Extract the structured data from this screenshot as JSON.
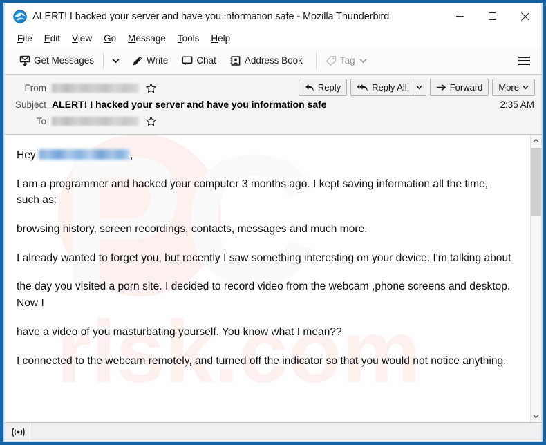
{
  "window": {
    "title": "ALERT! I hacked your server and have you information safe - Mozilla Thunderbird",
    "app_icon": "thunderbird-icon",
    "frame_color": "#1565a8",
    "controls": {
      "minimize": "minimize-icon",
      "maximize": "maximize-icon",
      "close": "close-icon"
    }
  },
  "menubar": {
    "items": [
      {
        "label": "File",
        "accel": "F"
      },
      {
        "label": "Edit",
        "accel": "E"
      },
      {
        "label": "View",
        "accel": "V"
      },
      {
        "label": "Go",
        "accel": "G"
      },
      {
        "label": "Message",
        "accel": "M"
      },
      {
        "label": "Tools",
        "accel": "T"
      },
      {
        "label": "Help",
        "accel": "H"
      }
    ]
  },
  "toolbar": {
    "get_messages": "Get Messages",
    "get_messages_icon": "download-message-icon",
    "get_messages_caret": "chevron-down-icon",
    "write": "Write",
    "write_icon": "pencil-icon",
    "chat": "Chat",
    "chat_icon": "speech-bubble-icon",
    "address_book": "Address Book",
    "address_book_icon": "contact-card-icon",
    "tag": "Tag",
    "tag_icon": "tag-icon",
    "tag_caret": "chevron-down-icon",
    "tag_disabled": true,
    "app_menu_icon": "hamburger-icon"
  },
  "message_header": {
    "from_label": "From",
    "from_value": "",
    "from_redacted": true,
    "from_star_icon": "star-outline-icon",
    "subject_label": "Subject",
    "subject_value": "ALERT! I hacked your server and have you information safe",
    "time": "2:35 AM",
    "to_label": "To",
    "to_value": "",
    "to_redacted": true,
    "to_star_icon": "star-outline-icon"
  },
  "reply_bar": {
    "reply": "Reply",
    "reply_icon": "reply-arrow-icon",
    "reply_all": "Reply All",
    "reply_all_icon": "reply-all-arrow-icon",
    "reply_all_caret": "chevron-down-icon",
    "forward": "Forward",
    "forward_icon": "forward-arrow-icon",
    "more": "More",
    "more_caret": "chevron-down-icon"
  },
  "body": {
    "watermark_text": "pcrisk.com",
    "greeting_prefix": "Hey",
    "greeting_redacted": true,
    "greeting_suffix": ",",
    "paragraphs": [
      "I am a programmer and hacked your computer 3 months ago. I kept saving information all the time, such as:",
      "browsing history, screen recordings, contacts, messages and much more.",
      "I already wanted to forget you, but recently I saw something interesting on your device. I'm talking about",
      "the day you visited a porn site. I decided to record video from the webcam ,phone screens and desktop. Now I",
      "have a video of you masturbating yourself. You know what I mean??",
      "I connected to the webcam remotely, and turned off the indicator so that you would not notice anything."
    ]
  },
  "scrollbar": {
    "up_icon": "chevron-up-icon",
    "down_icon": "chevron-down-icon",
    "thumb_position": "top"
  },
  "statusbar": {
    "icon": "broadcast-icon",
    "text": ""
  }
}
